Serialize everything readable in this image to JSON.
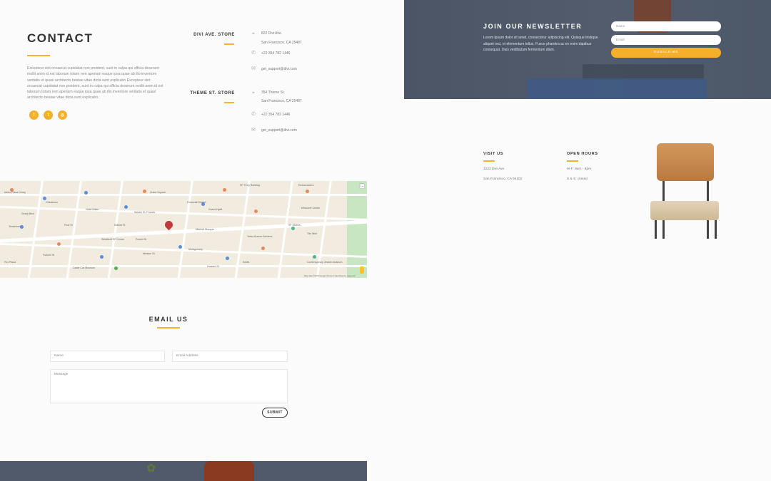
{
  "contact": {
    "title": "CONTACT",
    "body": "Excepteur sint occaecat cupidatat non proident, sunt in culpa qui officia deserunt mollit anim id est laborum totam rem aperiam eaque ipsa quae ab illo inventore veritatis et quasi architecto beatae vitae dicta sunt explicabo Excepteur sint occaecat cupidatat non proident, sunt in culpa qui officia deserunt mollit anim id est laborum totam rem aperiam eaque ipsa quae ab illo inventore veritatis et quasi architecto beatae vitae dicta sunt explicabo.",
    "social": [
      "f",
      "t",
      "◎"
    ]
  },
  "stores": [
    {
      "name": "DIVI AVE. STORE",
      "address1": "822 Divi Ave.",
      "address2": "San Francisco, CA 25487",
      "phone": "+22 354 782 1446",
      "email": "get_support@divi.com"
    },
    {
      "name": "THEME ST. STORE",
      "address1": "354 Theme St.",
      "address2": "San Francisco, CA 25487",
      "phone": "+22 354 782 1446",
      "email": "get_support@divi.com"
    }
  ],
  "newsletter": {
    "title": "JOIN OUR NEWSLETTER",
    "text": "Lorem ipsum dolor sit amet, consectetur adipiscing elit. Quisque tristique aliquet orci, et elementum tellus. Fusce pharetra ac ex enim dapibus consequat. Duis vestibulum fermentum diam.",
    "name_placeholder": "Name",
    "email_placeholder": "Email",
    "button": "SUBSCRIBE"
  },
  "visit": {
    "title": "VISIT US",
    "line1": "1223 Divi Ave",
    "line2": "San Francisco, CA 94102"
  },
  "hours": {
    "title": "OPEN HOURS",
    "line1": "M-F: 8am - 6pm",
    "line2": "S & S: closed"
  },
  "map": {
    "labels": [
      "Metro Plaza Geary",
      "SF Ferry Building",
      "Union Square",
      "Hotel Nikko",
      "Westin St. Francis",
      "Grand Hyatt",
      "Marriott Marquis",
      "Yerba Buena Gardens",
      "Moscone Center",
      "SF MOMA",
      "The Mint",
      "Contemporary Jewish Museum",
      "Embarcadero",
      "Fox Plaza",
      "Westfield SF Centre",
      "Cable Car Museum",
      "Chinatown",
      "Tenderloin",
      "SoMa",
      "Financial District",
      "Powell St",
      "Montgomery",
      "Market St",
      "Mission St",
      "Howard St",
      "Folsom St",
      "Geary Blvd",
      "Post St"
    ],
    "attribution": "Map data ©2019 Google   Terms of Use   Report a map error"
  },
  "email_us": {
    "title": "EMAIL US",
    "name_placeholder": "Name",
    "email_placeholder": "Email Address",
    "message_placeholder": "Message",
    "submit": "SUBMIT"
  },
  "colors": {
    "accent": "#f5b22e",
    "dark_banner": "#4b5566",
    "heading": "#333333"
  }
}
